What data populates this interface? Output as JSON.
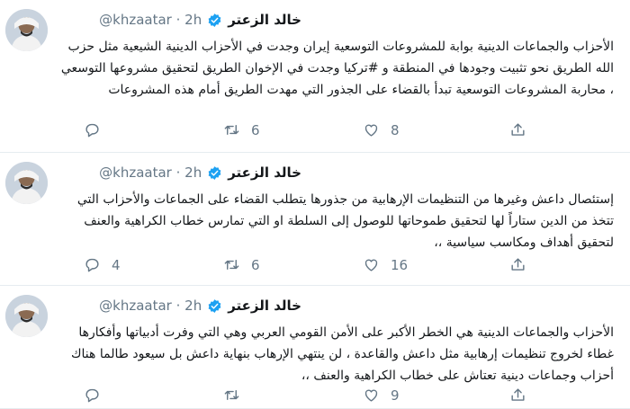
{
  "tweets": [
    {
      "display_name": "خالد الزعتر",
      "handle": "@khzaatar",
      "time": "2h",
      "text": "الأحزاب والجماعات الدينية بوابة للمشروعات التوسعية إيران وجدت في الأحزاب الدينية الشيعية مثل حزب الله الطريق نحو تثبيت وجودها في المنطقة و #تركيا وجدت في الإخوان الطريق لتحقيق مشروعها التوسعي ، محاربة المشروعات التوسعية تبدأ بالقضاء على الجذور التي مهدت الطريق أمام هذه المشروعات",
      "reply_count": "",
      "retweet_count": "6",
      "like_count": "8"
    },
    {
      "display_name": "خالد الزعتر",
      "handle": "@khzaatar",
      "time": "2h",
      "text": "إستئصال داعش وغيرها من التنظيمات الإرهابية من جذورها يتطلب القضاء على الجماعات والأحزاب التي تتخذ من الدين ستاراً لها لتحقيق طموحاتها للوصول إلى السلطة او التي تمارس خطاب الكراهية والعنف لتحقيق أهداف ومكاسب سياسية ،،",
      "reply_count": "4",
      "retweet_count": "6",
      "like_count": "16"
    },
    {
      "display_name": "خالد الزعتر",
      "handle": "@khzaatar",
      "time": "2h",
      "text": "الأحزاب والجماعات الدينية هي الخطر الأكبر على الأمن القومي العربي وهي التي وفرت أدبياتها وأفكارها غطاء لخروج تنظيمات إرهابية مثل داعش والقاعدة ، لن ينتهي الإرهاب بنهاية داعش بل سيعود طالما هناك أحزاب وجماعات دينية تعتاش على خطاب الكراهية والعنف ،،",
      "reply_count": "",
      "retweet_count": "",
      "like_count": "9"
    }
  ],
  "icons": {
    "verified": "verified-badge-icon",
    "reply": "reply-icon",
    "retweet": "retweet-icon",
    "like": "like-icon",
    "share": "share-icon"
  },
  "colors": {
    "verified": "#1da1f2",
    "icon": "#657786",
    "text": "#14171a",
    "divider": "#e6ecf0"
  }
}
